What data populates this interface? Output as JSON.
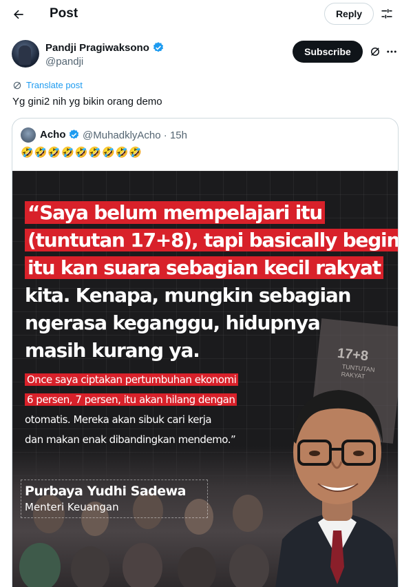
{
  "header": {
    "title": "Post",
    "reply_label": "Reply"
  },
  "author": {
    "name": "Pandji Pragiwaksono",
    "handle": "@pandji",
    "subscribe_label": "Subscribe",
    "verified": true
  },
  "post": {
    "translate_label": "Translate post",
    "text": "Yg gini2 nih yg bikin orang demo"
  },
  "quote": {
    "name": "Acho",
    "handle": "@MuhadklyAcho",
    "separator": "·",
    "time": "15h",
    "meta": "@MuhadklyAcho · 15h",
    "text": "🤣🤣🤣🤣🤣🤣🤣🤣🤣",
    "image": {
      "headline_lines": [
        "“Saya belum mempelajari itu",
        "(tuntutan 17+8), tapi basically begini,",
        "itu kan suara sebagian kecil rakyat",
        "kita. Kenapa, mungkin sebagian",
        "ngerasa keganggu, hidupnya",
        "masih kurang ya."
      ],
      "body_lines": [
        "Once saya ciptakan pertumbuhan ekonomi",
        "6 persen, 7 persen, itu akan hilang dengan",
        "otomatis. Mereka akan sibuk cari kerja",
        "dan makan enak dibandingkan mendemo.”"
      ],
      "person_name": "Purbaya Yudhi Sadewa",
      "person_title": "Menteri Keuangan",
      "sign_text": "17+8",
      "sign_sub": "TUNTUTAN RAKYAT"
    }
  },
  "colors": {
    "accent": "#1d9bf0",
    "highlight_red": "#d8212a",
    "text_primary": "#0f1419",
    "text_secondary": "#536471"
  },
  "icons": [
    "back-arrow-icon",
    "filter-icon",
    "verified-badge-icon",
    "grok-icon",
    "more-icon",
    "translate-icon"
  ]
}
